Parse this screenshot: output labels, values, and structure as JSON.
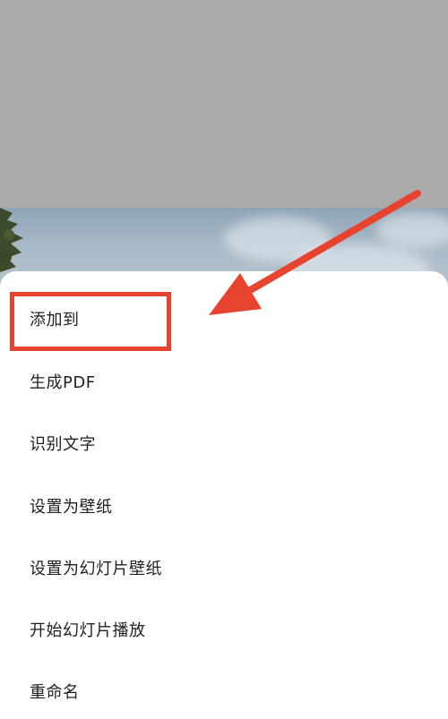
{
  "menu": {
    "items": [
      {
        "label": "添加到"
      },
      {
        "label": "生成PDF"
      },
      {
        "label": "识别文字"
      },
      {
        "label": "设置为壁纸"
      },
      {
        "label": "设置为幻灯片壁纸"
      },
      {
        "label": "开始幻灯片播放"
      },
      {
        "label": "重命名"
      }
    ]
  },
  "annotation": {
    "color": "#e8432e"
  }
}
